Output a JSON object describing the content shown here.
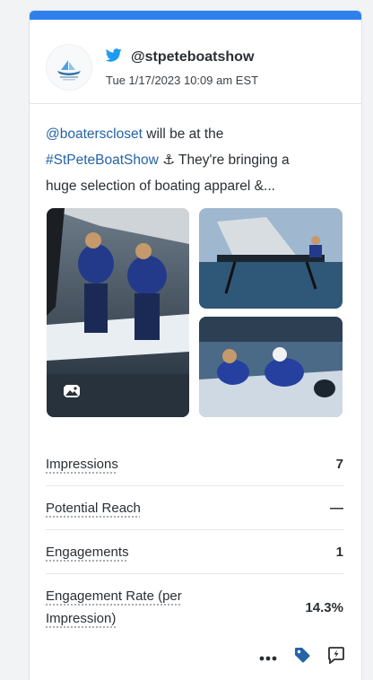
{
  "post": {
    "handle": "@stpeteboatshow",
    "datetime": "Tue 1/17/2023 10:09 am EST",
    "mention": "@boaterscloset",
    "text1": " will be at the",
    "hashtag": "#StPeteBoatShow",
    "anchor": " ⚓ ",
    "text2": "They're bringing a",
    "text3": "huge selection of boating apparel &..."
  },
  "metrics": [
    {
      "label": "Impressions",
      "value": "7"
    },
    {
      "label": "Potential Reach",
      "value": "—"
    },
    {
      "label": "Engagements",
      "value": "1"
    },
    {
      "label": "Engagement Rate (per Impression)",
      "value": "14.3%"
    }
  ],
  "colors": {
    "accent": "#2f80ed",
    "twitter": "#1d9bf0",
    "link": "#2463a6"
  },
  "icons": [
    "twitter-icon",
    "image-icon",
    "more-icon",
    "tag-icon",
    "reply-icon"
  ]
}
